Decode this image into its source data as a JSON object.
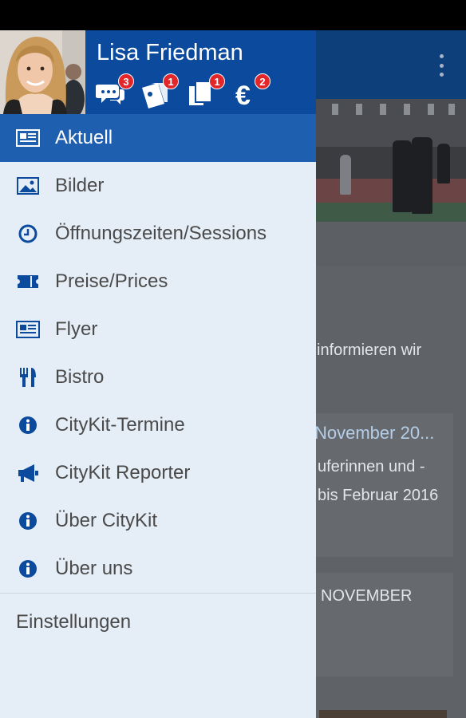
{
  "drawer": {
    "user_name": "Lisa Friedman",
    "notifications": [
      {
        "icon": "chat-bubbles-icon",
        "count": "3"
      },
      {
        "icon": "tickets-icon",
        "count": "1"
      },
      {
        "icon": "documents-icon",
        "count": "1"
      },
      {
        "icon": "euro-icon",
        "count": "2"
      }
    ],
    "items": [
      {
        "label": "Aktuell",
        "icon": "newspaper-icon",
        "active": true
      },
      {
        "label": "Bilder",
        "icon": "picture-icon"
      },
      {
        "label": "Öffnungszeiten/Sessions",
        "icon": "clock-icon"
      },
      {
        "label": "Preise/Prices",
        "icon": "ticket-icon"
      },
      {
        "label": "Flyer",
        "icon": "newspaper-icon"
      },
      {
        "label": "Bistro",
        "icon": "cutlery-icon"
      },
      {
        "label": "CityKit-Termine",
        "icon": "info-icon"
      },
      {
        "label": "CityKit Reporter",
        "icon": "megaphone-icon"
      },
      {
        "label": "Über CityKit",
        "icon": "info-icon"
      },
      {
        "label": "Über uns",
        "icon": "info-icon"
      }
    ],
    "settings_label": "Einstellungen"
  },
  "background": {
    "intro_text": "informieren wir",
    "card1_title": "November 20...",
    "card1_line1": "uferinnen und -",
    "card1_line2": "bis Februar 2016",
    "card2_title": "NOVEMBER"
  },
  "colors": {
    "accent": "#1f5fb0",
    "header": "#0b4a9c",
    "badge": "#e3262a",
    "drawer_bg": "#e5edf6"
  }
}
